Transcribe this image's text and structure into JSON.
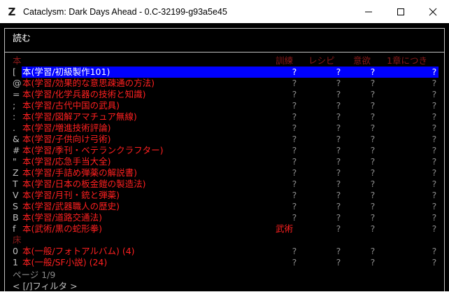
{
  "window": {
    "title": "Cataclysm: Dark Days Ahead - 0.C-32199-g93a5e45",
    "app_icon_glyph": "Z"
  },
  "menu": {
    "title": "読む",
    "columns": {
      "training": "訓練",
      "recipe": "レシピ",
      "motivation": "意欲",
      "per_chapter": "1章につき"
    }
  },
  "groups": [
    {
      "label": "本",
      "items": [
        {
          "symbol": "[",
          "name": "本(学習/初級製作101)",
          "training": "?",
          "recipe": "?",
          "motivation": "?",
          "per_chapter": "?",
          "selected": true
        },
        {
          "symbol": "@",
          "name": "本(学習/効果的な意思疎通の方法)",
          "training": "?",
          "recipe": "?",
          "motivation": "?",
          "per_chapter": "?"
        },
        {
          "symbol": "=",
          "name": "本(学習/化学兵器の技術と知識)",
          "training": "?",
          "recipe": "?",
          "motivation": "?",
          "per_chapter": "?"
        },
        {
          "symbol": ";",
          "name": "本(学習/古代中国の武具)",
          "training": "?",
          "recipe": "?",
          "motivation": "?",
          "per_chapter": "?"
        },
        {
          "symbol": ":",
          "name": "本(学習/図解アマチュア無線)",
          "training": "?",
          "recipe": "?",
          "motivation": "?",
          "per_chapter": "?"
        },
        {
          "symbol": ".",
          "name": "本(学習/増進技術評論)",
          "training": "?",
          "recipe": "?",
          "motivation": "?",
          "per_chapter": "?"
        },
        {
          "symbol": "&",
          "name": "本(学習/子供向け弓術)",
          "training": "?",
          "recipe": "?",
          "motivation": "?",
          "per_chapter": "?"
        },
        {
          "symbol": "#",
          "name": "本(学習/季刊・ベテランクラフター)",
          "training": "?",
          "recipe": "?",
          "motivation": "?",
          "per_chapter": "?"
        },
        {
          "symbol": "\"",
          "name": "本(学習/応急手当大全)",
          "training": "?",
          "recipe": "?",
          "motivation": "?",
          "per_chapter": "?"
        },
        {
          "symbol": "Z",
          "name": "本(学習/手詰め弾薬の解説書)",
          "training": "?",
          "recipe": "?",
          "motivation": "?",
          "per_chapter": "?"
        },
        {
          "symbol": "T",
          "name": "本(学習/日本の板金鎧の製造法)",
          "training": "?",
          "recipe": "?",
          "motivation": "?",
          "per_chapter": "?"
        },
        {
          "symbol": "V",
          "name": "本(学習/月刊・銃と弾薬)",
          "training": "?",
          "recipe": "?",
          "motivation": "?",
          "per_chapter": "?"
        },
        {
          "symbol": "S",
          "name": "本(学習/武器職人の歴史)",
          "training": "?",
          "recipe": "?",
          "motivation": "?",
          "per_chapter": "?"
        },
        {
          "symbol": "B",
          "name": "本(学習/道路交通法)",
          "training": "?",
          "recipe": "?",
          "motivation": "?",
          "per_chapter": "?"
        },
        {
          "symbol": "f",
          "name": "本(武術/黒の蛇形拳)",
          "training": "武術",
          "recipe": "?",
          "motivation": "?",
          "per_chapter": "?"
        }
      ]
    },
    {
      "label": "床",
      "items": [
        {
          "symbol": "0",
          "name": "本(一般/フォトアルバム) (4)",
          "training": "?",
          "recipe": "?",
          "motivation": "?",
          "per_chapter": "?"
        },
        {
          "symbol": "1",
          "name": "本(一般/SF小説) (24)",
          "training": "?",
          "recipe": "?",
          "motivation": "?",
          "per_chapter": "?"
        }
      ]
    }
  ],
  "footer": {
    "page": "ページ 1/9",
    "filter": "< [/]フィルタ >"
  },
  "colors": {
    "selection": "#0000ff",
    "item_text": "#ff2020",
    "category": "#8a1a1a",
    "dim": "#8a8a8a"
  }
}
